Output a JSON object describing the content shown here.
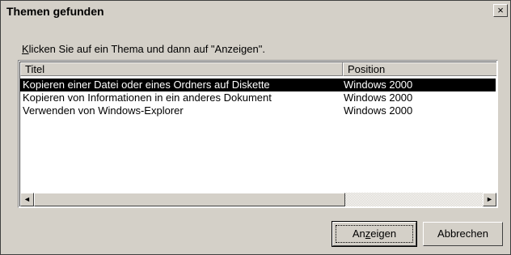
{
  "dialog": {
    "title": "Themen gefunden",
    "close_label": "×",
    "instruction_prefix": "K",
    "instruction_rest": "licken Sie auf ein Thema und dann auf \"Anzeigen\"."
  },
  "list": {
    "columns": [
      "Titel",
      "Position"
    ],
    "rows": [
      {
        "title": "Kopieren einer Datei oder eines Ordners auf Diskette",
        "position": "Windows 2000",
        "selected": true
      },
      {
        "title": "Kopieren von Informationen in ein anderes Dokument",
        "position": "Windows 2000",
        "selected": false
      },
      {
        "title": "Verwenden von Windows-Explorer",
        "position": "Windows 2000",
        "selected": false
      }
    ]
  },
  "scrollbar": {
    "left_arrow": "◄",
    "right_arrow": "►"
  },
  "buttons": {
    "show_pre": "An",
    "show_mnemonic": "z",
    "show_post": "eigen",
    "cancel": "Abbrechen"
  }
}
